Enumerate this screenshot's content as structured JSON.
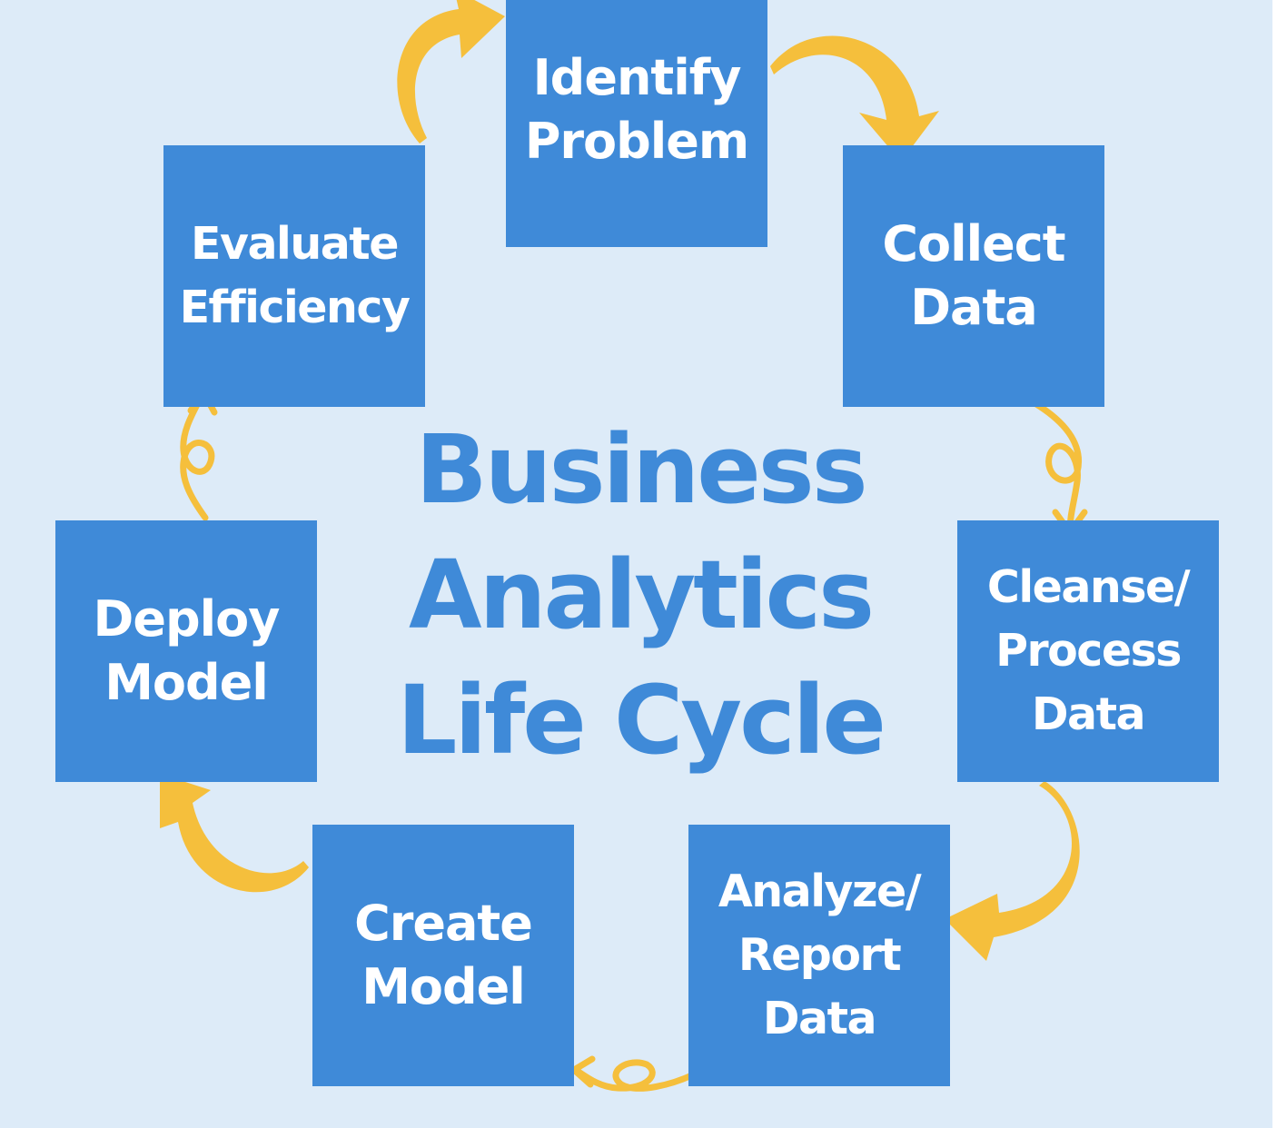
{
  "title": {
    "lines": [
      "Business",
      "Analytics",
      "Life Cycle"
    ]
  },
  "steps": [
    {
      "lines": [
        "Identify",
        "Problem"
      ]
    },
    {
      "lines": [
        "Collect",
        "Data"
      ]
    },
    {
      "lines": [
        "Cleanse/",
        "Process",
        "Data"
      ]
    },
    {
      "lines": [
        "Analyze/",
        "Report",
        "Data"
      ]
    },
    {
      "lines": [
        "Create",
        "Model"
      ]
    },
    {
      "lines": [
        "Deploy",
        "Model"
      ]
    },
    {
      "lines": [
        "Evaluate",
        "Efficiency"
      ]
    }
  ],
  "colors": {
    "background": "#ddebf8",
    "box": "#3f8ad8",
    "box_text": "#ffffff",
    "title_text": "#3f8ad8",
    "arrow": "#f5bf3c"
  }
}
